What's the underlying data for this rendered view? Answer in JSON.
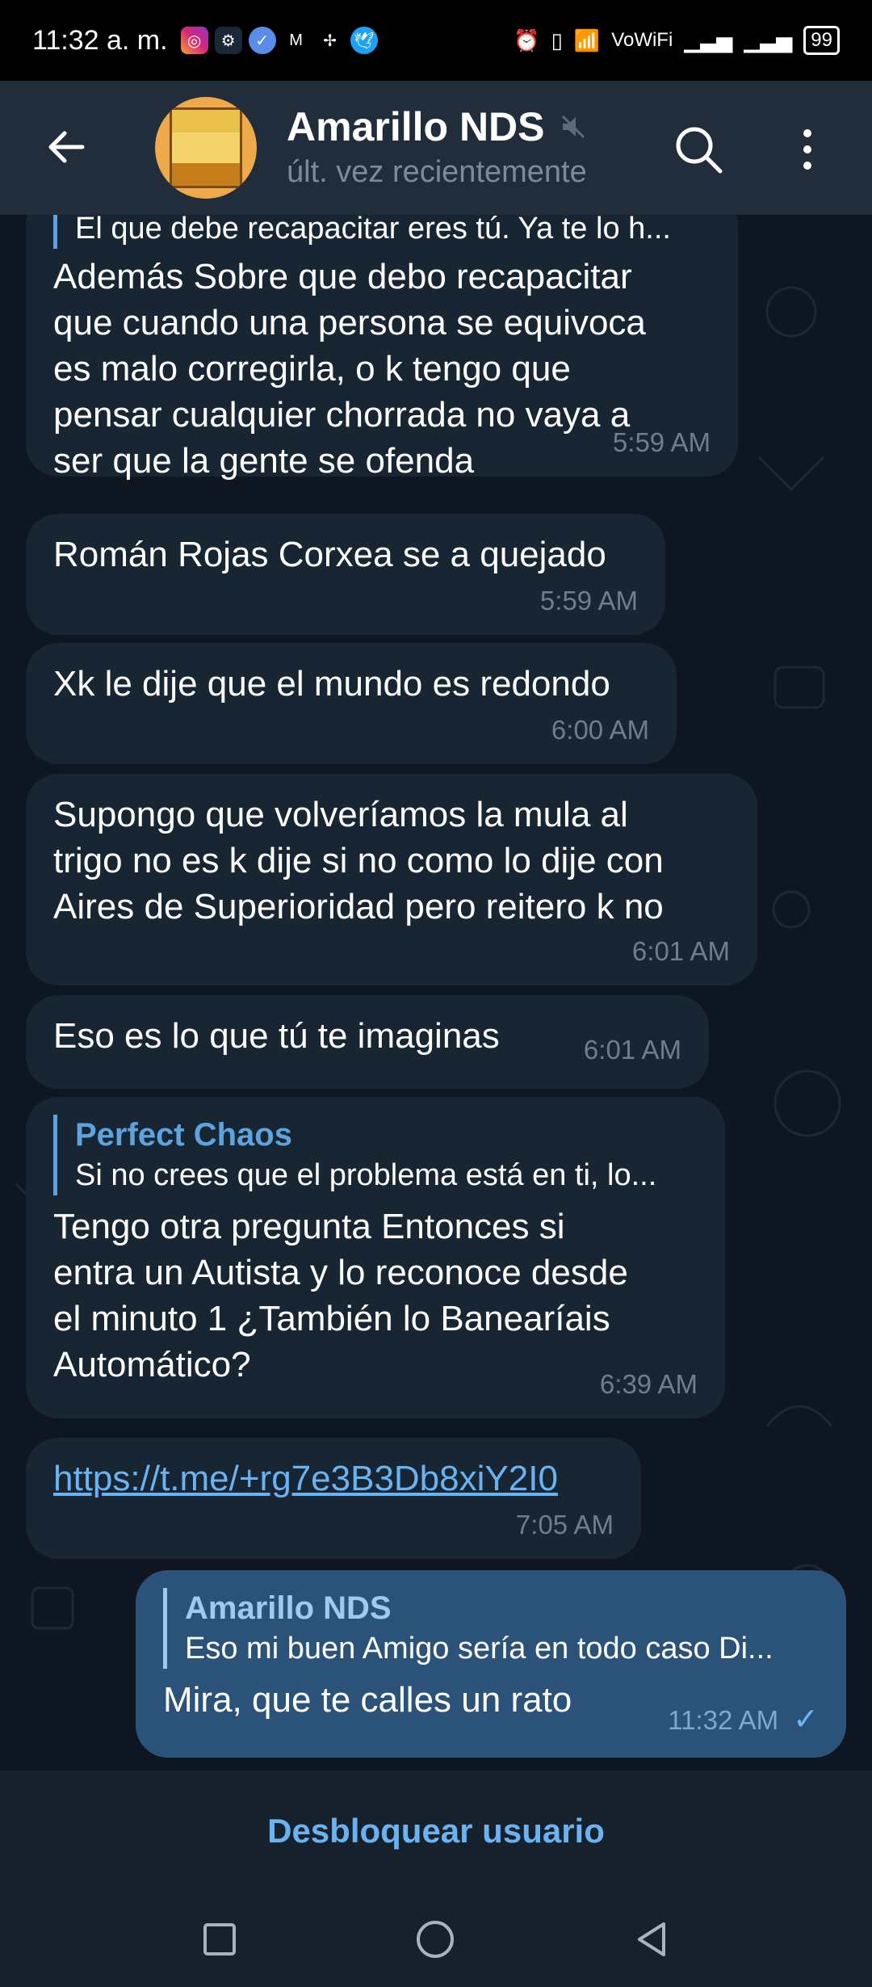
{
  "status_bar": {
    "time": "11:32 a. m.",
    "network": "VoWiFi",
    "battery": "99"
  },
  "header": {
    "title": "Amarillo NDS",
    "subtitle": "últ. vez recientemente"
  },
  "messages": [
    {
      "reply_text": "El que debe recapacitar eres tú. Ya te lo h...",
      "lines": [
        "Además Sobre que debo recapacitar",
        "que cuando una persona se equivoca",
        "es malo corregirla, o k tengo que",
        "pensar cualquier chorrada no vaya a",
        "ser que la gente se ofenda"
      ],
      "time": "5:59 AM"
    },
    {
      "text": "Román Rojas Corxea se a quejado",
      "time": "5:59 AM"
    },
    {
      "text": "Xk le dije que el mundo es redondo",
      "time": "6:00 AM"
    },
    {
      "lines": [
        "Supongo que volveríamos la mula al",
        "trigo no es k dije si no como lo dije con",
        "Aires de Superioridad pero reitero k no"
      ],
      "time": "6:01 AM"
    },
    {
      "text": "Eso es lo que tú te imaginas",
      "time": "6:01 AM"
    },
    {
      "reply_name": "Perfect Chaos",
      "reply_text": "Si no crees que el problema está en ti, lo...",
      "lines": [
        "Tengo otra pregunta Entonces si",
        "entra un Autista y lo reconoce desde",
        "el minuto 1 ¿También lo Banearíais",
        "Automático?"
      ],
      "time": "6:39 AM"
    },
    {
      "text": "https://t.me/+rg7e3B3Db8xiY2I0",
      "time": "7:05 AM"
    },
    {
      "reply_name": "Amarillo NDS",
      "reply_text": "Eso mi buen Amigo sería en todo caso Di...",
      "text": "Mira, que te calles un rato",
      "time": "11:32 AM"
    }
  ],
  "bottom": {
    "unblock_label": "Desbloquear usuario"
  },
  "colors": {
    "background": "#0e1621",
    "incoming": "#182533",
    "outgoing": "#2b5278",
    "accent": "#6ab3f3"
  }
}
